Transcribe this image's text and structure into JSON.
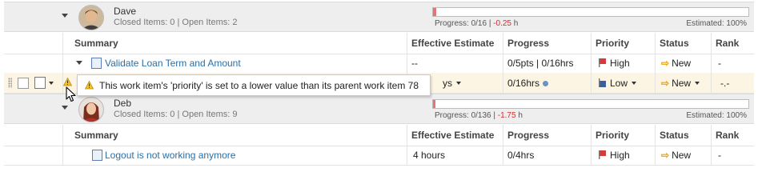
{
  "groups": [
    {
      "name": "Dave",
      "stats": "Closed Items: 0 | Open Items: 2",
      "progress_prefix": "Progress: 0/16 | ",
      "progress_neg": "-0.25",
      "progress_suffix": " h",
      "estimated": "Estimated: 100%",
      "capacity_fill": 0.01,
      "columns": [
        "Summary",
        "Effective Estimate",
        "Progress",
        "Priority",
        "Status",
        "Rank"
      ],
      "rows": [
        {
          "summary": "Validate Loan Term and Amount",
          "estimate": "--",
          "progress": "0/5pts | 0/16hrs",
          "priority": "High",
          "status": "New",
          "rank": "-"
        },
        {
          "estimate": "ys",
          "progress": "0/16hrs",
          "priority": "Low",
          "status": "New",
          "rank": "-.-"
        }
      ]
    },
    {
      "name": "Deb",
      "stats": "Closed Items: 0 | Open Items: 9",
      "progress_prefix": "Progress: 0/136 | ",
      "progress_neg": "-1.75",
      "progress_suffix": " h",
      "estimated": "Estimated: 100%",
      "capacity_fill": 0.01,
      "columns": [
        "Summary",
        "Effective Estimate",
        "Progress",
        "Priority",
        "Status",
        "Rank"
      ],
      "rows": [
        {
          "summary": "Logout is not working anymore",
          "estimate": "4 hours",
          "progress": "0/4hrs",
          "priority": "High",
          "status": "New",
          "rank": "-"
        }
      ]
    }
  ],
  "tooltip": {
    "text": "This work item's 'priority' is set to a lower value than its parent work item 78"
  },
  "colors": {
    "high_flag": "#d63a3a",
    "low_flag": "#3b5f9b",
    "new_arrow": "#e8a317",
    "link": "#2a6fa8",
    "negative": "#d62d2d"
  }
}
